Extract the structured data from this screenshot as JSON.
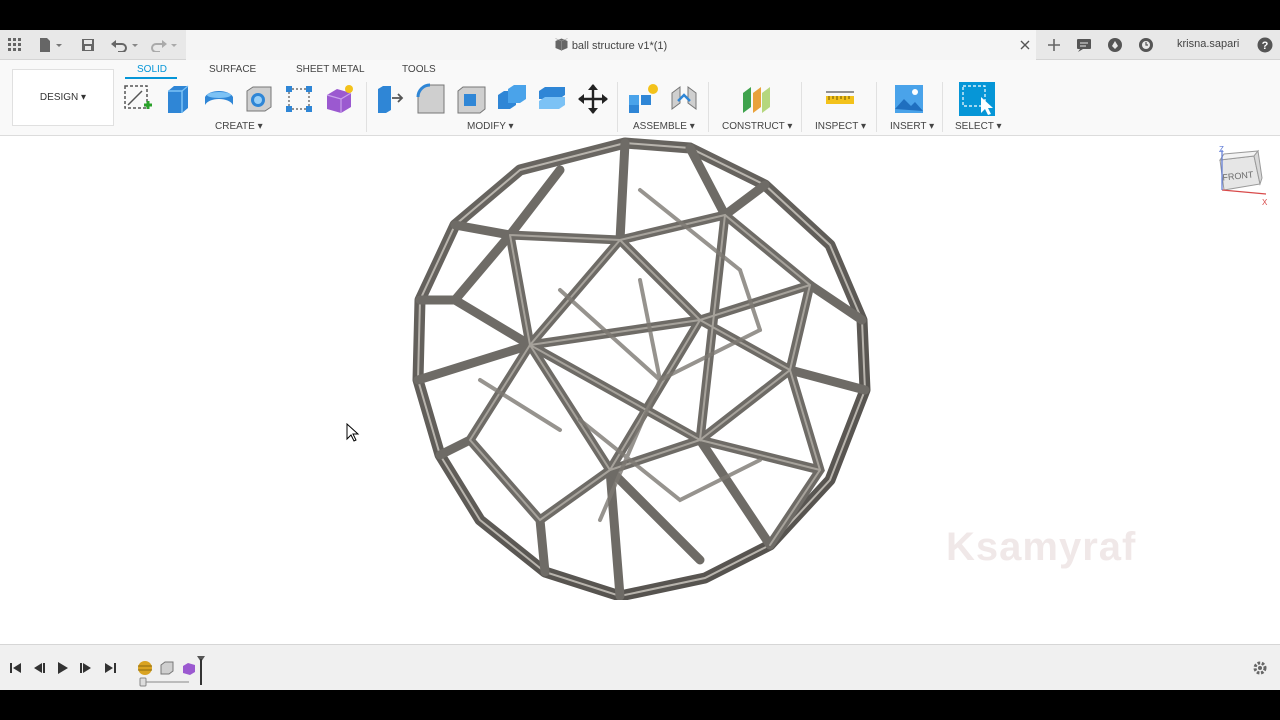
{
  "window": {
    "document_title": "ball structure v1*(1)",
    "username": "krisna.sapari"
  },
  "workspace": {
    "label": "DESIGN ▾"
  },
  "workspace_tabs": [
    {
      "label": "SOLID",
      "active": true
    },
    {
      "label": "SURFACE",
      "active": false
    },
    {
      "label": "SHEET METAL",
      "active": false
    },
    {
      "label": "TOOLS",
      "active": false
    }
  ],
  "tool_groups": [
    {
      "label": "CREATE ▾",
      "tools": [
        "create-sketch-icon",
        "extrude-icon",
        "revolve-icon",
        "hole-icon",
        "pattern-icon",
        "form-icon"
      ]
    },
    {
      "label": "MODIFY ▾",
      "tools": [
        "press-pull-icon",
        "fillet-icon",
        "shell-icon",
        "combine-icon",
        "offset-face-icon",
        "move-icon"
      ]
    },
    {
      "label": "ASSEMBLE ▾",
      "tools": [
        "new-component-icon",
        "joint-icon"
      ]
    },
    {
      "label": "CONSTRUCT ▾",
      "tools": [
        "offset-plane-icon"
      ]
    },
    {
      "label": "INSPECT ▾",
      "tools": [
        "measure-icon"
      ]
    },
    {
      "label": "INSERT ▾",
      "tools": [
        "insert-image-icon"
      ]
    },
    {
      "label": "SELECT ▾",
      "tools": [
        "select-icon"
      ]
    }
  ],
  "viewcube": {
    "face_label": "FRONT",
    "axis_z": "Z",
    "axis_x": "X"
  },
  "watermark": "Ksamyraf",
  "colors": {
    "accent": "#0696d7",
    "model": "#6e6b66",
    "canvas": "#ffffff"
  }
}
